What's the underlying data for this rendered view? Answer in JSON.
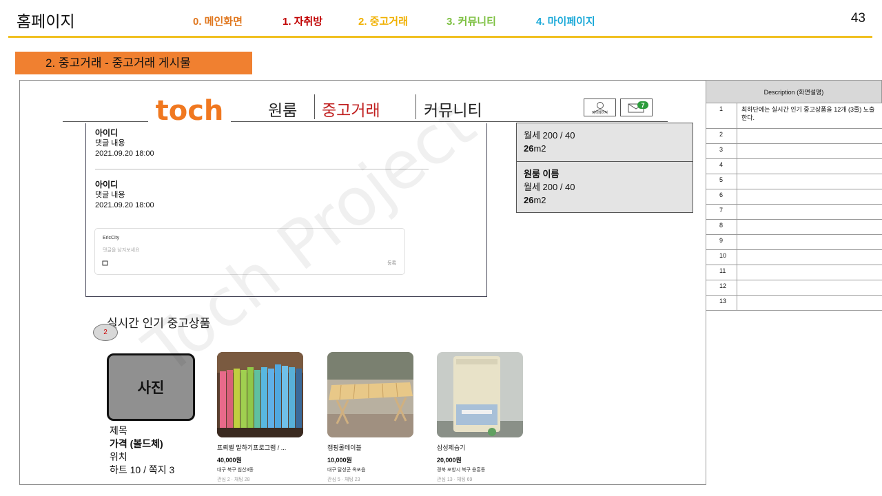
{
  "slide": {
    "title": "홈페이지",
    "page_number": "43",
    "nav": [
      {
        "label": "0. 메인화면",
        "color": "#e07820"
      },
      {
        "label": "1. 자취방",
        "color": "#c00000"
      },
      {
        "label": "2. 중고거래",
        "color": "#f0b000"
      },
      {
        "label": "3. 커뮤니티",
        "color": "#7cc040"
      },
      {
        "label": "4. 마이페이지",
        "color": "#18a8d8"
      }
    ],
    "section_label": "2. 중고거래 - 중고거래 게시물"
  },
  "site": {
    "logo": "toch",
    "nav": [
      {
        "label": "원룸"
      },
      {
        "label": "중고거래",
        "active": true
      },
      {
        "label": "커뮤니티"
      }
    ],
    "mypage_label": "마이페이지",
    "message_count": "7"
  },
  "watermark": "Toch Project",
  "comments": [
    {
      "id": "아이디",
      "content": "댓글 내용",
      "date": "2021.09.20 18:00"
    },
    {
      "id": "아이디",
      "content": "댓글 내용",
      "date": "2021.09.20 18:00"
    }
  ],
  "reply": {
    "user": "EricCity",
    "placeholder": "댓글을 남겨보세요",
    "attach_icon": "camera-icon",
    "submit": "등록"
  },
  "listings": [
    {
      "name": "",
      "price": "월세 200 / 40",
      "size_num": "26",
      "size_unit": "m2"
    },
    {
      "name": "원룸 이름",
      "price": "월세 200 / 40",
      "size_num": "26",
      "size_unit": "m2"
    }
  ],
  "popular": {
    "title": "실시간 인기 중고상품",
    "marker": "2",
    "template": {
      "photo": "사진",
      "title": "제목",
      "price": "가격 (볼드체)",
      "location": "위치",
      "stats": "하트 10 / 쪽지 3"
    },
    "products": [
      {
        "title": "프뢰벨 말하기프로그램 / ...",
        "price": "40,000원",
        "location": "대구 북구 침산3동",
        "stats": "관심 2 · 채팅 28"
      },
      {
        "title": "캠핑롤테이블",
        "price": "10,000원",
        "location": "대구 달성군 옥포읍",
        "stats": "관심 5 · 채팅 23"
      },
      {
        "title": "삼성제습기",
        "price": "20,000원",
        "location": "경북 포항시 북구 용흥동",
        "stats": "관심 13 · 채팅 69"
      }
    ]
  },
  "description": {
    "header": "Description (화면설명)",
    "rows": [
      {
        "num": "1",
        "text": "최하단에는 실시간 인기 중고상품을 12개 (3줄) 노출한다."
      },
      {
        "num": "2",
        "text": ""
      },
      {
        "num": "3",
        "text": ""
      },
      {
        "num": "4",
        "text": ""
      },
      {
        "num": "5",
        "text": ""
      },
      {
        "num": "6",
        "text": ""
      },
      {
        "num": "7",
        "text": ""
      },
      {
        "num": "8",
        "text": ""
      },
      {
        "num": "9",
        "text": ""
      },
      {
        "num": "10",
        "text": ""
      },
      {
        "num": "11",
        "text": ""
      },
      {
        "num": "12",
        "text": ""
      },
      {
        "num": "13",
        "text": ""
      }
    ]
  },
  "colors": {
    "accent_gold": "#f0c020",
    "banner_orange": "#f08030",
    "logo_orange": "#f07820",
    "active_red": "#d82020"
  }
}
